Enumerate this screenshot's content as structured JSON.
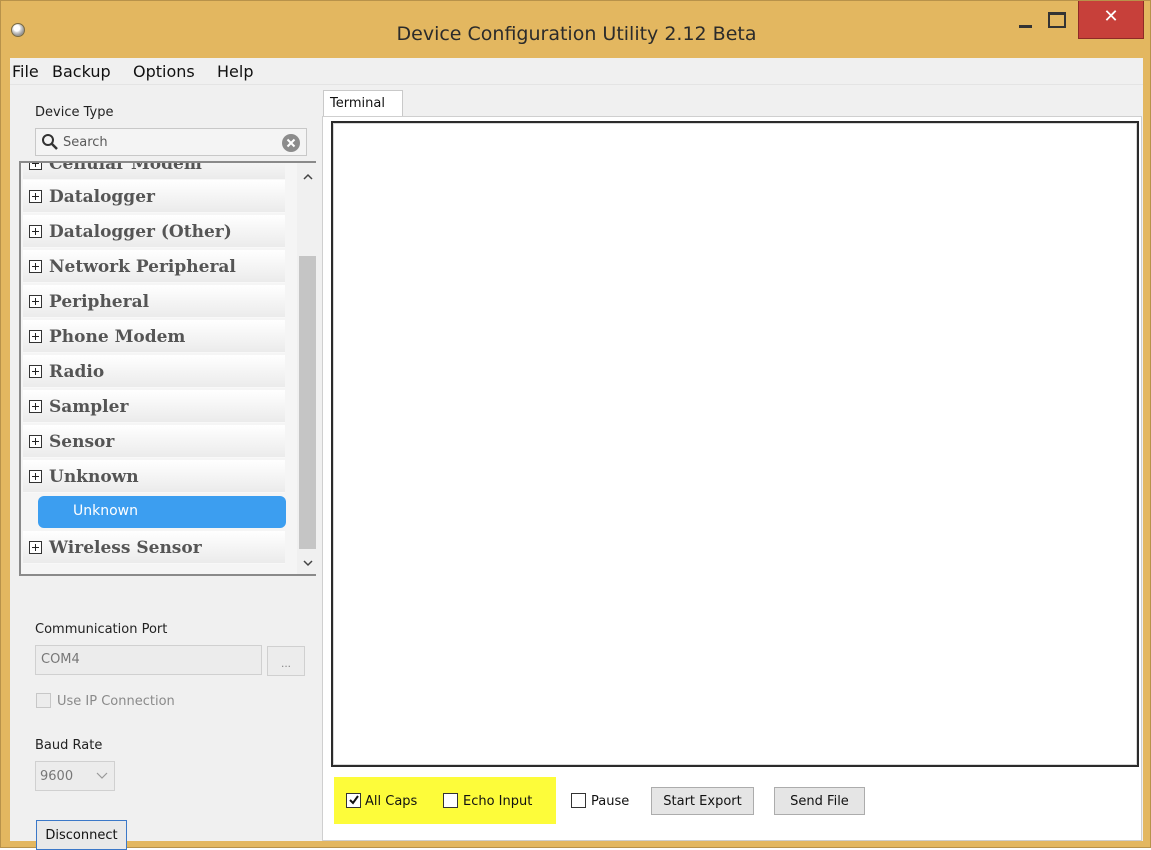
{
  "window": {
    "title": "Device Configuration Utility 2.12 Beta",
    "close_glyph": "✕",
    "icons": [
      "app-icon",
      "minimize-icon",
      "maximize-icon",
      "close-icon"
    ]
  },
  "menu": {
    "items": [
      "File",
      "Backup",
      "Options",
      "Help"
    ]
  },
  "device_panel": {
    "label": "Device Type",
    "search": {
      "placeholder": "Search",
      "value": ""
    },
    "tree": {
      "partial_top_item": "Cellular Modem",
      "items": [
        "Datalogger",
        "Datalogger (Other)",
        "Network Peripheral",
        "Peripheral",
        "Phone Modem",
        "Radio",
        "Sampler",
        "Sensor",
        "Unknown"
      ],
      "selected_child": "Unknown",
      "last_item": "Wireless Sensor"
    }
  },
  "connection": {
    "port_label": "Communication Port",
    "port_value": "COM4",
    "browse_label": "...",
    "use_ip_label": "Use IP Connection",
    "use_ip_checked": false,
    "baud_label": "Baud Rate",
    "baud_value": "9600",
    "disconnect_label": "Disconnect"
  },
  "terminal": {
    "tab_label": "Terminal",
    "all_caps_label": "All Caps",
    "all_caps_checked": true,
    "echo_input_label": "Echo Input",
    "echo_input_checked": false,
    "pause_label": "Pause",
    "pause_checked": false,
    "start_export_label": "Start Export",
    "send_file_label": "Send File",
    "highlight_color": "#fdfc3a"
  },
  "colors": {
    "title_bar": "#e3b760",
    "close_button": "#c7403a",
    "selection": "#3c9ef0"
  }
}
